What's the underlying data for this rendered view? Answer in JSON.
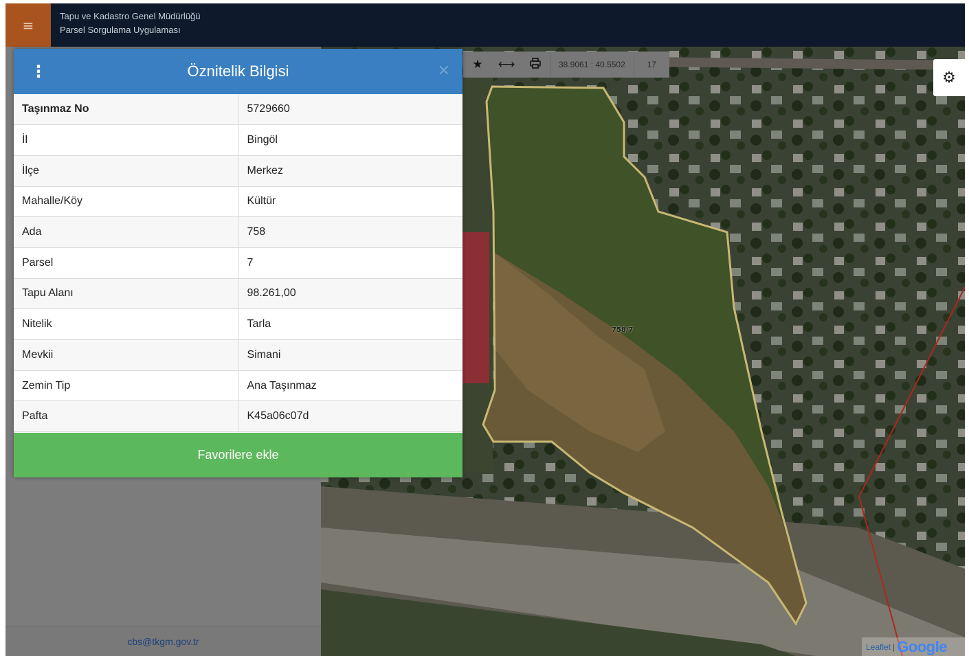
{
  "header": {
    "menu_icon": "hamburger-icon",
    "title_line1": "Tapu ve Kadastro Genel Müdürlüğü",
    "title_line2": "Parsel Sorgulama Uygulaması"
  },
  "map_toolbar": {
    "icons": [
      "star-icon",
      "measure-icon",
      "print-icon"
    ],
    "coordinates": "38.9061 : 40.5502",
    "zoom_level": "17"
  },
  "map": {
    "parcel_label": "758/7",
    "parcel_outline_color": "#c8b873",
    "boundary_line_color": "#b0261c",
    "settings_icon": "gear-icon"
  },
  "attribution": {
    "leaflet": "Leaflet",
    "separator": "|",
    "google": "Google"
  },
  "side_panel": {
    "footer_email": "cbs@tkgm.gov.tr"
  },
  "attr_panel": {
    "title": "Öznitelik Bilgisi",
    "menu_icon": "vertical-dots-icon",
    "close_icon": "close-icon",
    "header_color": "#3a7fc1",
    "rows": [
      {
        "key": "Taşınmaz No",
        "value": "5729660"
      },
      {
        "key": "İl",
        "value": "Bingöl"
      },
      {
        "key": "İlçe",
        "value": "Merkez"
      },
      {
        "key": "Mahalle/Köy",
        "value": "Kültür"
      },
      {
        "key": "Ada",
        "value": "758"
      },
      {
        "key": "Parsel",
        "value": "7"
      },
      {
        "key": "Tapu Alanı",
        "value": "98.261,00"
      },
      {
        "key": "Nitelik",
        "value": "Tarla"
      },
      {
        "key": "Mevkii",
        "value": "Simani"
      },
      {
        "key": "Zemin Tip",
        "value": "Ana Taşınmaz"
      },
      {
        "key": "Pafta",
        "value": "K45a06c07d"
      }
    ],
    "favorite_button": "Favorilere ekle",
    "favorite_color": "#5cb85c"
  }
}
